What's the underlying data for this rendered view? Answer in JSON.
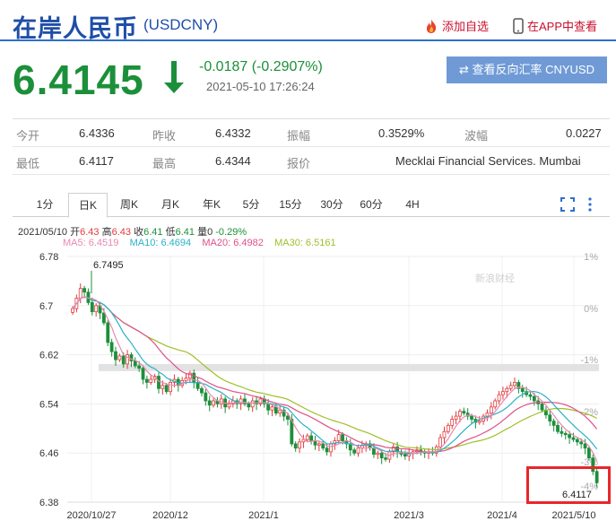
{
  "header": {
    "title": "在岸人民币",
    "code": "(USDCNY)",
    "add_watch": "添加自选",
    "app_view": "在APP中查看"
  },
  "quote": {
    "price": "6.4145",
    "change": "-0.0187 (-0.2907%)",
    "timestamp": "2021-05-10 17:26:24",
    "reverse_button": "⇄ 查看反向汇率 CNYUSD",
    "color_down": "#1c8f3a",
    "color_up": "#e23b3b"
  },
  "stats": {
    "row1": [
      {
        "label": "今开",
        "value": "6.4336"
      },
      {
        "label": "昨收",
        "value": "6.4332"
      },
      {
        "label": "振幅",
        "value": "0.3529%"
      },
      {
        "label": "波幅",
        "value": "0.0227"
      }
    ],
    "row2": [
      {
        "label": "最低",
        "value": "6.4117"
      },
      {
        "label": "最高",
        "value": "6.4344"
      },
      {
        "label": "报价",
        "value": "Mecklai Financial Services. Mumbai"
      }
    ]
  },
  "tabs": [
    "1分",
    "日K",
    "周K",
    "月K",
    "年K",
    "5分",
    "15分",
    "30分",
    "60分",
    "4H"
  ],
  "active_tab": "日K",
  "ohlc_info": {
    "date": "2021/05/10",
    "open_l": "开",
    "open": "6.43",
    "high_l": "高",
    "high": "6.43",
    "close_l": "收",
    "close": "6.41",
    "low_l": "低",
    "low": "6.41",
    "vol_l": "量",
    "vol": "0",
    "pct": "-0.29%"
  },
  "ma_info": {
    "ma5": "MA5: 6.4519",
    "ma10": "MA10: 6.4694",
    "ma20": "MA20: 6.4982",
    "ma30": "MA30: 6.5161"
  },
  "chart_data": {
    "type": "candlestick",
    "y_ticks": [
      "6.78",
      "6.7",
      "6.62",
      "6.54",
      "6.46",
      "6.38"
    ],
    "pct_ticks": [
      "1%",
      "0%",
      "-1%",
      "-2%",
      "-3%",
      "-4%"
    ],
    "x_ticks": [
      "2020/10/27",
      "2020/12",
      "2021/1",
      "2021/3",
      "2021/4",
      "2021/5/10"
    ],
    "ylim": [
      6.38,
      6.78
    ],
    "max_label": "6.7495",
    "last_label": "6.4117",
    "watermark": "新浪财经",
    "series_colors": {
      "MA5": "#e0508a",
      "MA10": "#2ab2c8",
      "MA20": "#e0508a",
      "MA30": "#9fbf2a",
      "up": "#e23b3b",
      "down": "#1c8f3a"
    },
    "closes": [
      6.695,
      6.712,
      6.728,
      6.722,
      6.705,
      6.69,
      6.7,
      6.688,
      6.672,
      6.64,
      6.625,
      6.612,
      6.618,
      6.605,
      6.62,
      6.61,
      6.602,
      6.598,
      6.58,
      6.575,
      6.58,
      6.585,
      6.565,
      6.57,
      6.56,
      6.575,
      6.58,
      6.57,
      6.578,
      6.582,
      6.59,
      6.575,
      6.565,
      6.558,
      6.545,
      6.538,
      6.545,
      6.54,
      6.548,
      6.535,
      6.54,
      6.545,
      6.54,
      6.548,
      6.54,
      6.535,
      6.545,
      6.54,
      6.548,
      6.54,
      6.53,
      6.535,
      6.525,
      6.53,
      6.52,
      6.515,
      6.475,
      6.468,
      6.478,
      6.482,
      6.488,
      6.48,
      6.473,
      6.475,
      6.468,
      6.462,
      6.475,
      6.48,
      6.49,
      6.48,
      6.475,
      6.465,
      6.46,
      6.468,
      6.472,
      6.475,
      6.468,
      6.458,
      6.46,
      6.452,
      6.45,
      6.462,
      6.47,
      6.462,
      6.458,
      6.455,
      6.46,
      6.462,
      6.465,
      6.462,
      6.46,
      6.462,
      6.46,
      6.47,
      6.485,
      6.495,
      6.505,
      6.515,
      6.52,
      6.528,
      6.525,
      6.52,
      6.515,
      6.51,
      6.512,
      6.52,
      6.525,
      6.535,
      6.545,
      6.555,
      6.56,
      6.565,
      6.57,
      6.575,
      6.565,
      6.56,
      6.555,
      6.552,
      6.545,
      6.54,
      6.53,
      6.522,
      6.512,
      6.505,
      6.495,
      6.492,
      6.49,
      6.485,
      6.482,
      6.478,
      6.475,
      6.468,
      6.452,
      6.43,
      6.4117
    ]
  }
}
